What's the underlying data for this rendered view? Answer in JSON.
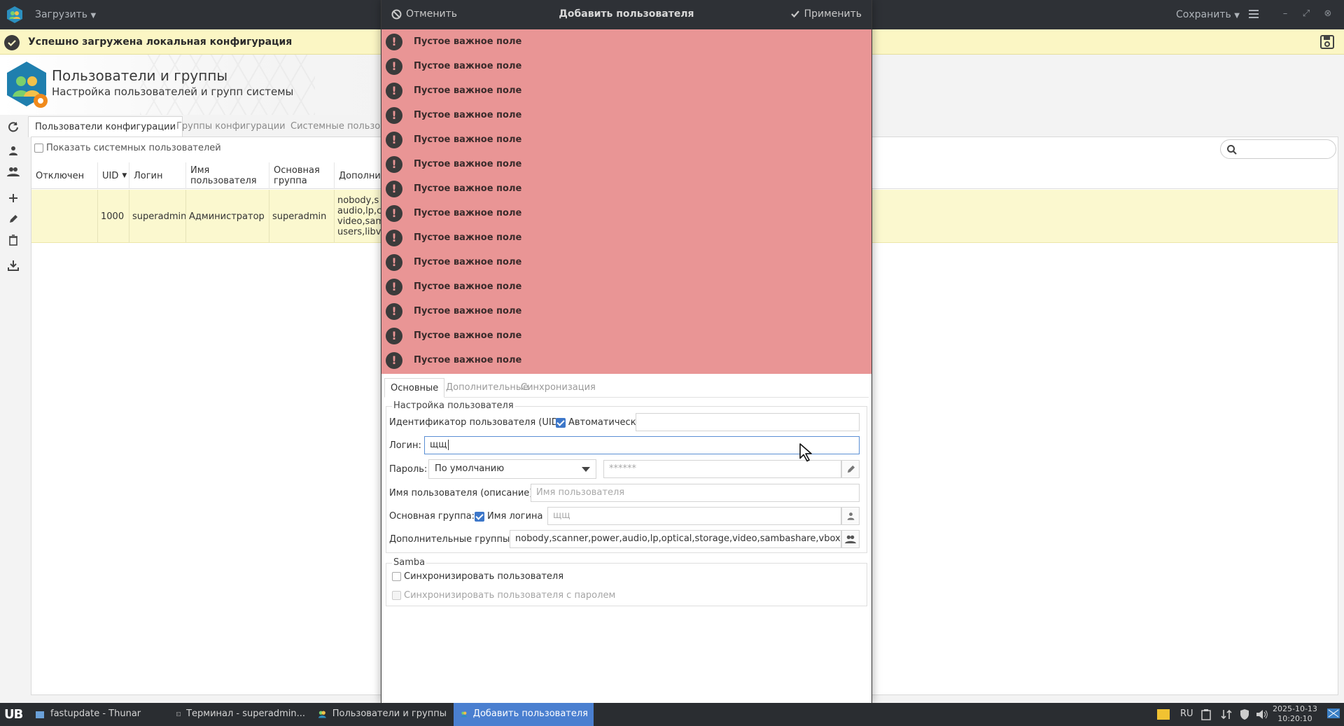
{
  "main_window": {
    "load_label": "Загрузить",
    "save_label": "Сохранить",
    "info_message": "Успешно загружена локальная конфигурация",
    "banner_title": "Пользователи и группы",
    "banner_subtitle": "Настройка пользователей и групп системы",
    "tabs": [
      {
        "label": "Пользователи конфигурации",
        "active": true
      },
      {
        "label": "Группы конфигурации",
        "active": false
      },
      {
        "label": "Системные пользова",
        "active": false
      }
    ],
    "show_system_users_label": "Показать системных пользователей",
    "table": {
      "columns": [
        "Отключен",
        "UID",
        "Логин",
        "Имя пользователя",
        "Основная группа",
        "Дополни"
      ],
      "rows": [
        {
          "disabled": "",
          "uid": "1000",
          "login": "superadmin",
          "name": "Администратор",
          "group": "superadmin",
          "extra": "nobody,s audio,lp,c video,sam users,libv"
        }
      ]
    }
  },
  "dialog": {
    "cancel_label": "Отменить",
    "title": "Добавить пользователя",
    "apply_label": "Применить",
    "errors": [
      "Пустое важное поле",
      "Пустое важное поле",
      "Пустое важное поле",
      "Пустое важное поле",
      "Пустое важное поле",
      "Пустое важное поле",
      "Пустое важное поле",
      "Пустое важное поле",
      "Пустое важное поле",
      "Пустое важное поле",
      "Пустое важное поле",
      "Пустое важное поле",
      "Пустое важное поле",
      "Пустое важное поле"
    ],
    "tabs": [
      {
        "label": "Основные",
        "active": true
      },
      {
        "label": "Дополнительные",
        "active": false
      },
      {
        "label": "Синхронизация",
        "active": false
      }
    ],
    "user_settings": {
      "legend": "Настройка пользователя",
      "uid_label": "Идентификатор пользователя (UID):",
      "uid_auto_label": "Автоматически",
      "uid_auto_checked": true,
      "uid_value": "",
      "login_label": "Логин:",
      "login_value": "щщ",
      "password_label": "Пароль:",
      "password_mode": "По умолчанию",
      "password_value": "******",
      "username_label": "Имя пользователя (описание):",
      "username_placeholder": "Имя пользователя",
      "main_group_label": "Основная группа:",
      "main_group_login_label": "Имя логина",
      "main_group_login_checked": true,
      "main_group_value": "щщ",
      "extra_groups_label": "Дополнительные группы:",
      "extra_groups_value": "nobody,scanner,power,audio,lp,optical,storage,video,sambashare,vboxusers,l"
    },
    "samba": {
      "legend": "Samba",
      "sync_user_label": "Синхронизировать пользователя",
      "sync_password_label": "Синхронизировать пользователя с паролем"
    }
  },
  "taskbar": {
    "start_label": "UB",
    "tasks": [
      {
        "label": "fastupdate - Thunar",
        "active": false
      },
      {
        "label": "Терминал - superadmin...",
        "active": false
      },
      {
        "label": "Пользователи и группы",
        "active": false
      },
      {
        "label": "Добавить пользователя",
        "active": true
      }
    ],
    "keyboard_layout": "RU",
    "date": "2025-10-13",
    "time": "10:20:10"
  },
  "colors": {
    "header_bg": "#2e3136",
    "error_bg": "#e99595",
    "info_bg": "#fbf6c4",
    "accent": "#3d77c9",
    "taskbar_active": "#4a7fd0"
  }
}
